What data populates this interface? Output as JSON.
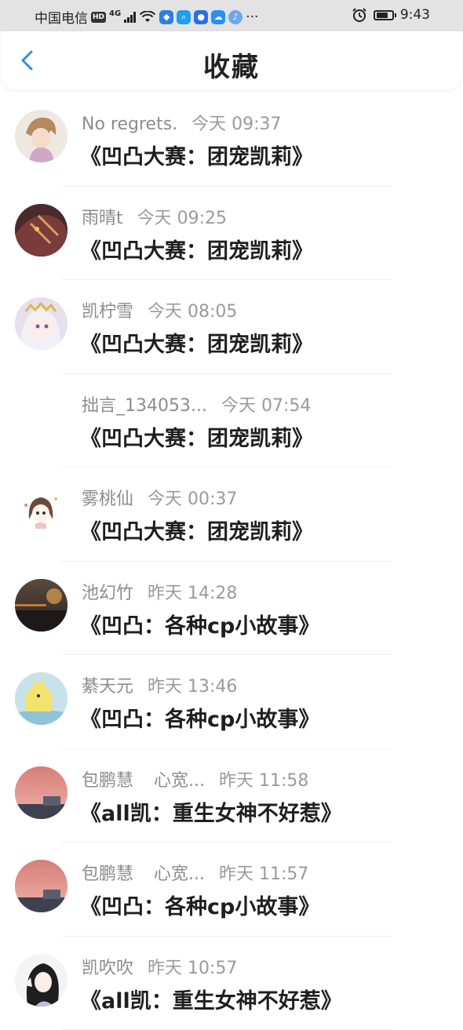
{
  "status_bar": {
    "carrier": "中国电信",
    "hd": "HD",
    "net": "4G",
    "time": "9:43",
    "dots": "···"
  },
  "header": {
    "title": "收藏"
  },
  "items": [
    {
      "sender": "No regrets.",
      "sender2": "",
      "time": "今天 09:37",
      "title": "《凹凸大赛：团宠凯莉》",
      "avatar": "anime-boy-avatar",
      "bg": "#e9dfd8"
    },
    {
      "sender": "雨晴t",
      "sender2": "",
      "time": "今天 09:25",
      "title": "《凹凸大赛：团宠凯莉》",
      "avatar": "dark-red-anime-avatar",
      "bg": "#5a3434"
    },
    {
      "sender": "凯柠雪",
      "sender2": "",
      "time": "今天 08:05",
      "title": "《凹凸大赛：团宠凯莉》",
      "avatar": "white-hair-anime-girl-avatar",
      "bg": "#dcd6e6"
    },
    {
      "sender": "拙言_134053...",
      "sender2": "",
      "time": "今天 07:54",
      "title": "《凹凸大赛：团宠凯莉》",
      "avatar": "",
      "bg": ""
    },
    {
      "sender": "雾桃仙",
      "sender2": "",
      "time": "今天 00:37",
      "title": "《凹凸大赛：团宠凯莉》",
      "avatar": "chibi-girl-avatar",
      "bg": "#ffffff"
    },
    {
      "sender": "池幻竹",
      "sender2": "",
      "time": "昨天 14:28",
      "title": "《凹凸：各种cp小故事》",
      "avatar": "sunset-photo-avatar",
      "bg": "#3b2f2a"
    },
    {
      "sender": "綦天元",
      "sender2": "",
      "time": "昨天 13:46",
      "title": "《凹凸：各种cp小故事》",
      "avatar": "yellow-cartoon-avatar",
      "bg": "#b9d8e4"
    },
    {
      "sender": "包鹏慧",
      "sender2": "心宽...",
      "time": "昨天 11:58",
      "title": "《all凯：重生女神不好惹》",
      "avatar": "pink-sky-photo-avatar",
      "bg": "#d98a86"
    },
    {
      "sender": "包鹏慧",
      "sender2": "心宽...",
      "time": "昨天 11:57",
      "title": "《凹凸：各种cp小故事》",
      "avatar": "pink-sky-photo-avatar",
      "bg": "#d98a86"
    },
    {
      "sender": "凯吹吹",
      "sender2": "",
      "time": "昨天 10:57",
      "title": "《all凯：重生女神不好惹》",
      "avatar": "black-hair-girl-avatar",
      "bg": "#f2f2f2"
    }
  ],
  "colors": {
    "accent": "#2f8fe0",
    "title": "#1f1f1f",
    "meta": "#8c8c8c",
    "status_bg": "#e3e3e3"
  }
}
